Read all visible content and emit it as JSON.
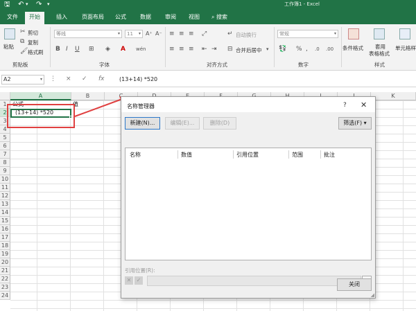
{
  "titlebar": {
    "window_title": "工作簿1 - Excel",
    "save_icon": "save-icon",
    "undo_icon": "undo-icon"
  },
  "tabs": [
    "文件",
    "开始",
    "插入",
    "页面布局",
    "公式",
    "数据",
    "审阅",
    "视图"
  ],
  "search": {
    "label": "搜索"
  },
  "ribbon": {
    "clipboard": {
      "paste": "粘贴",
      "cut": "剪切",
      "copy": "复制",
      "format_painter": "格式刷",
      "group": "剪贴板"
    },
    "font": {
      "name": "等线",
      "size": "11",
      "group": "字体"
    },
    "alignment": {
      "wrap": "自动换行",
      "merge": "合并后居中",
      "group": "对齐方式"
    },
    "number": {
      "format": "常规",
      "group": "数字"
    },
    "styles": {
      "conditional": "条件格式",
      "table_format_1": "套用",
      "table_format_2": "表格格式",
      "cell_styles": "单元格样",
      "group": "样式"
    }
  },
  "formula_bar": {
    "name_box": "A2",
    "cancel_icon": "×",
    "enter_icon": "✓",
    "fx": "fx",
    "content": "(13+14)  *520"
  },
  "grid": {
    "columns": [
      "A",
      "B",
      "C",
      "D",
      "E",
      "F",
      "G",
      "H",
      "I",
      "J",
      "K"
    ],
    "rows": [
      "1",
      "2",
      "3",
      "4",
      "5",
      "6",
      "7",
      "8",
      "9",
      "10",
      "11",
      "12",
      "13",
      "14",
      "15",
      "16",
      "17",
      "18",
      "19",
      "20",
      "21",
      "22",
      "23",
      "24"
    ],
    "cell_a1": "公式",
    "cell_b1": "值",
    "cell_a2": "(13+14)  *520"
  },
  "dialog": {
    "title": "名称管理器",
    "help": "?",
    "close": "✕",
    "new_button": "新建(N)...",
    "edit_button": "编辑(E)...",
    "delete_button": "删除(D)",
    "filter_button": "筛选(F) ▾",
    "columns": [
      "名称",
      "数值",
      "引用位置",
      "范围",
      "批注"
    ],
    "ref_label": "引用位置(R):",
    "close_button": "关闭"
  },
  "colors": {
    "excel_green": "#217346",
    "annotation_red": "#e04040"
  }
}
